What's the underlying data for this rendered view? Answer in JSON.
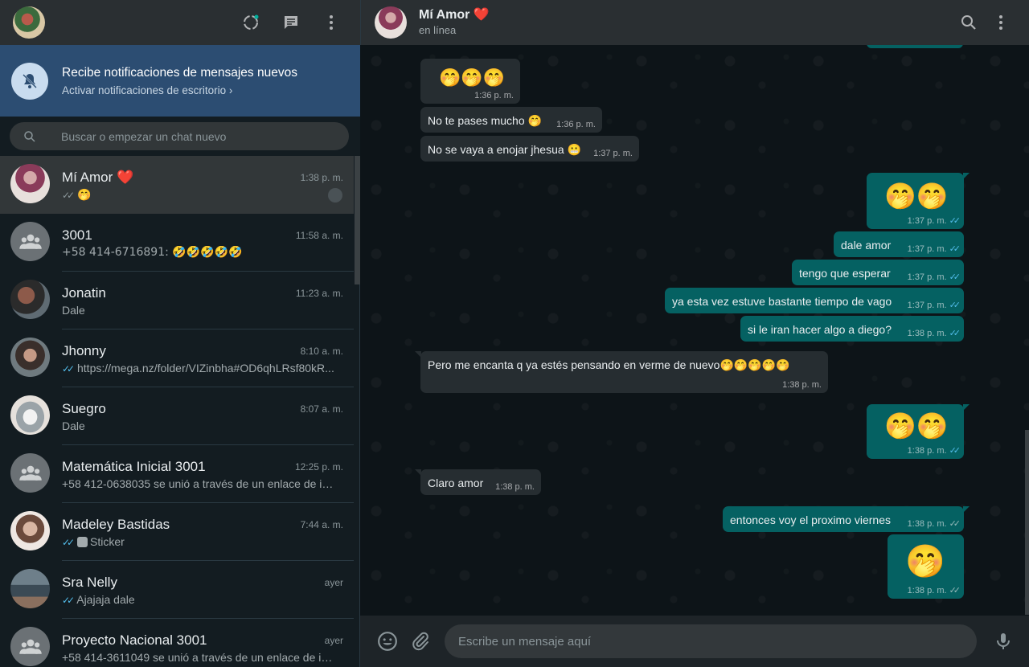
{
  "colors": {
    "panel": "#2a2f32",
    "sidebar": "#131c21",
    "notif": "#2c4d72",
    "outgoing": "#056162",
    "incoming": "#262d31",
    "blue_tick": "#53bdeb"
  },
  "left_header": {
    "icons": [
      "status-icon",
      "new-chat-icon",
      "menu-icon"
    ]
  },
  "notification": {
    "title": "Recibe notificaciones de mensajes nuevos",
    "subtitle": "Activar notificaciones de escritorio ›"
  },
  "search": {
    "placeholder": "Buscar o empezar un chat nuevo"
  },
  "chats": [
    {
      "name": "Mí Amor ❤️",
      "time": "1:38 p. m.",
      "preview": "🤭",
      "ticks": "✓✓",
      "tick_color": "grey",
      "pinned": true,
      "group": false
    },
    {
      "name": "3001",
      "time": "11:58 a. m.",
      "preview": "+58 414-6716891: 🤣🤣🤣🤣🤣",
      "ticks": "",
      "group": true
    },
    {
      "name": "Jonatin",
      "time": "11:23 a. m.",
      "preview": "Dale",
      "ticks": "",
      "group": false
    },
    {
      "name": "Jhonny",
      "time": "8:10 a. m.",
      "preview": "https://mega.nz/folder/VIZinbha#OD6qhLRsf80kR...",
      "ticks": "✓✓",
      "tick_color": "blue",
      "group": false
    },
    {
      "name": "Suegro",
      "time": "8:07 a. m.",
      "preview": "Dale",
      "ticks": "",
      "group": false
    },
    {
      "name": "Matemática Inicial 3001",
      "time": "12:25 p. m.",
      "preview": "+58 412-0638035 se unió a través de un enlace de inv...",
      "ticks": "",
      "group": true
    },
    {
      "name": "Madeley Bastidas",
      "time": "7:44 a. m.",
      "preview": "Sticker",
      "ticks": "✓✓",
      "tick_color": "blue",
      "group": false
    },
    {
      "name": "Sra Nelly",
      "time": "ayer",
      "preview": "Ajajaja dale",
      "ticks": "✓✓",
      "tick_color": "blue",
      "group": false
    },
    {
      "name": "Proyecto Nacional 3001",
      "time": "ayer",
      "preview": "+58 414-3611049 se unió a través de un enlace de inv...",
      "ticks": "",
      "group": true
    }
  ],
  "conversation": {
    "name": "Mí Amor ❤️",
    "status": "en línea",
    "icons": [
      "search-icon",
      "menu-icon"
    ],
    "messages": [
      {
        "dir": "in",
        "text": "🤭🤭🤭",
        "time": "1:36 p. m."
      },
      {
        "dir": "in",
        "text": "No te pases mucho 🤭",
        "time": "1:36 p. m."
      },
      {
        "dir": "in",
        "text": "No se vaya a enojar jhesua 😬",
        "time": "1:37 p. m."
      },
      {
        "dir": "out",
        "text": "🤭🤭",
        "time": "1:37 p. m.",
        "ticks": "✓✓",
        "tick_color": "blue"
      },
      {
        "dir": "out",
        "text": "dale amor",
        "time": "1:37 p. m.",
        "ticks": "✓✓",
        "tick_color": "blue"
      },
      {
        "dir": "out",
        "text": "tengo que esperar",
        "time": "1:37 p. m.",
        "ticks": "✓✓",
        "tick_color": "blue"
      },
      {
        "dir": "out",
        "text": "ya esta vez estuve bastante tiempo de vago",
        "time": "1:37 p. m.",
        "ticks": "✓✓",
        "tick_color": "blue"
      },
      {
        "dir": "out",
        "text": "si le iran hacer algo a diego?",
        "time": "1:38 p. m.",
        "ticks": "✓✓",
        "tick_color": "blue"
      },
      {
        "dir": "in",
        "text": "Pero me encanta q ya estés pensando en verme de nuevo🤭🤭🤭🤭🤭",
        "time": "1:38 p. m."
      },
      {
        "dir": "out",
        "text": "🤭🤭",
        "time": "1:38 p. m.",
        "ticks": "✓✓",
        "tick_color": "blue"
      },
      {
        "dir": "in",
        "text": "Claro amor",
        "time": "1:38 p. m."
      },
      {
        "dir": "out",
        "text": "entonces voy el proximo viernes",
        "time": "1:38 p. m.",
        "ticks": "✓✓",
        "tick_color": "grey"
      },
      {
        "dir": "out",
        "text": "🤭",
        "time": "1:38 p. m.",
        "ticks": "✓✓",
        "tick_color": "grey"
      }
    ]
  },
  "composer": {
    "placeholder": "Escribe un mensaje aquí",
    "icons": [
      "emoji-icon",
      "attach-icon",
      "microphone-icon"
    ]
  }
}
